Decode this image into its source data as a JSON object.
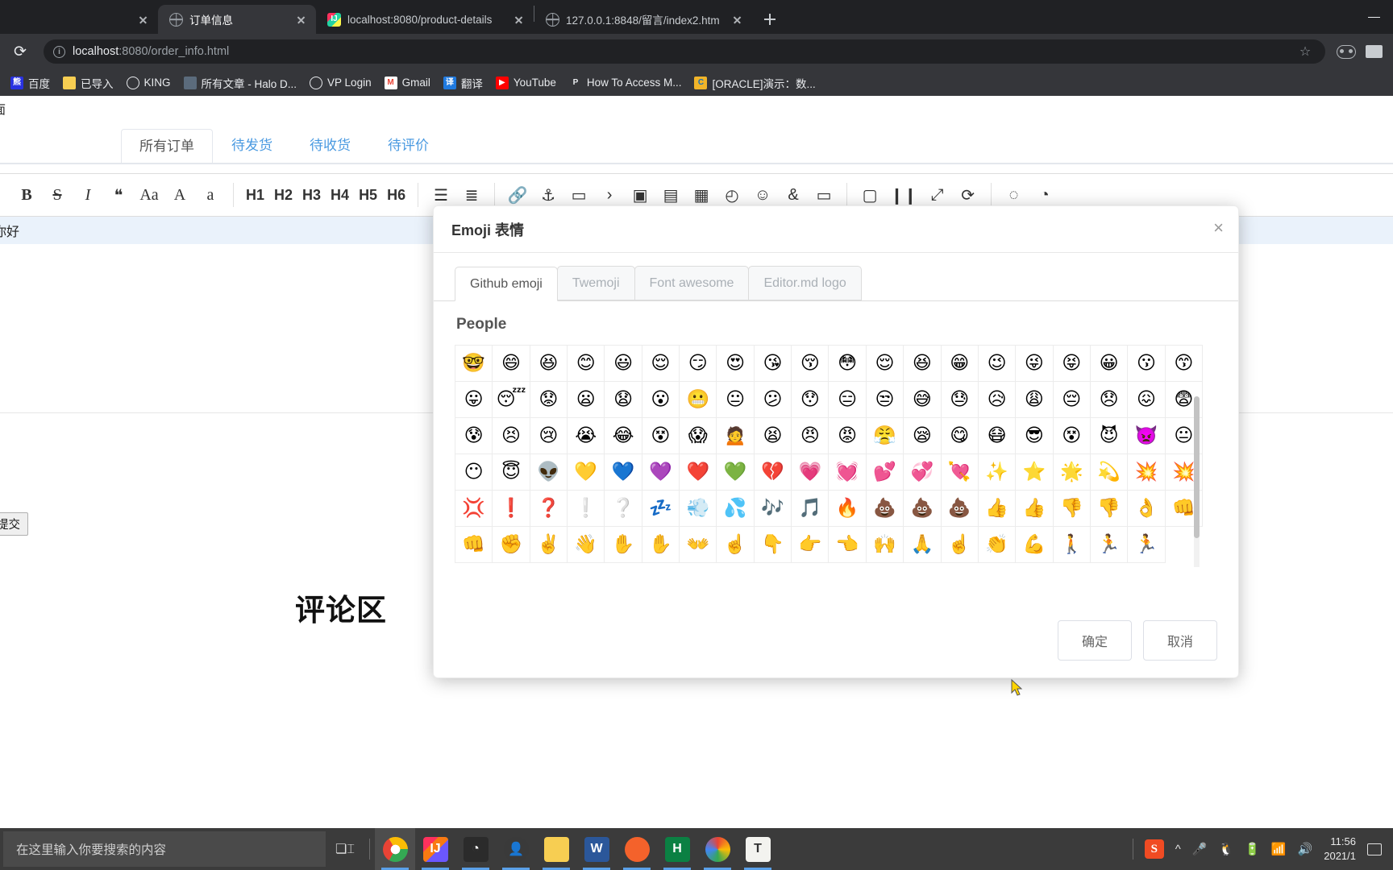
{
  "browser": {
    "tabs": [
      {
        "title": "",
        "favicon": "globe-icon",
        "active": false,
        "partial": true
      },
      {
        "title": "订单信息",
        "favicon": "globe-icon",
        "active": true,
        "partial": false
      },
      {
        "title": "localhost:8080/product-details",
        "favicon": "intellij-idea-icon",
        "active": false,
        "partial": false
      },
      {
        "title": "127.0.0.1:8848/留言/index2.htm",
        "favicon": "globe-icon",
        "active": false,
        "partial": false
      }
    ],
    "new_tab_label": "+",
    "minimize_label": "—",
    "omnibox": {
      "host": "localhost",
      "path": ":8080/order_info.html",
      "site_info_icon": "info-circle-icon",
      "star_icon": "☆"
    },
    "bookmarks": [
      {
        "label": "百度",
        "icon": "baidu-icon"
      },
      {
        "label": "已导入",
        "icon": "folder-icon"
      },
      {
        "label": "KING",
        "icon": "king-icon"
      },
      {
        "label": "所有文章 - Halo D...",
        "icon": "halo-icon"
      },
      {
        "label": "VP Login",
        "icon": "vp-icon"
      },
      {
        "label": "Gmail",
        "icon": "gmail-icon"
      },
      {
        "label": "翻译",
        "icon": "translate-icon"
      },
      {
        "label": "YouTube",
        "icon": "youtube-icon"
      },
      {
        "label": "How To Access M...",
        "icon": "pocket-icon"
      },
      {
        "label": "[ORACLE]演示：数...",
        "icon": "oracle-icon"
      }
    ]
  },
  "page": {
    "top_fragment_text": "面",
    "order_tabs": [
      {
        "label": "所有订单",
        "active": true
      },
      {
        "label": "待发货",
        "active": false
      },
      {
        "label": "待收货",
        "active": false
      },
      {
        "label": "待评价",
        "active": false
      }
    ],
    "editor_toolbar": [
      {
        "icon": "bold-icon",
        "glyph": "B"
      },
      {
        "icon": "strikethrough-icon",
        "glyph": "S"
      },
      {
        "icon": "italic-icon",
        "glyph": "I"
      },
      {
        "icon": "quote-icon",
        "glyph": "❝"
      },
      {
        "icon": "font-size-icon",
        "glyph": "Aa"
      },
      {
        "icon": "uppercase-icon",
        "glyph": "A"
      },
      {
        "icon": "lowercase-icon",
        "glyph": "a"
      },
      {
        "icon": "heading-1-icon",
        "glyph": "H1"
      },
      {
        "icon": "heading-2-icon",
        "glyph": "H2"
      },
      {
        "icon": "heading-3-icon",
        "glyph": "H3"
      },
      {
        "icon": "heading-4-icon",
        "glyph": "H4"
      },
      {
        "icon": "heading-5-icon",
        "glyph": "H5"
      },
      {
        "icon": "heading-6-icon",
        "glyph": "H6"
      },
      {
        "icon": "unordered-list-icon",
        "glyph": "☰"
      },
      {
        "icon": "ordered-list-icon",
        "glyph": "≣"
      },
      {
        "icon": "link-icon",
        "glyph": "🔗"
      },
      {
        "icon": "reference-link-icon",
        "glyph": "⚓"
      },
      {
        "icon": "image-icon",
        "glyph": "▭"
      },
      {
        "icon": "code-icon",
        "glyph": "›"
      },
      {
        "icon": "code-block-icon",
        "glyph": "▣"
      },
      {
        "icon": "preformatted-icon",
        "glyph": "▤"
      },
      {
        "icon": "table-icon",
        "glyph": "▦"
      },
      {
        "icon": "datetime-icon",
        "glyph": "◴"
      },
      {
        "icon": "emoji-icon",
        "glyph": "☺"
      },
      {
        "icon": "html-entity-icon",
        "glyph": "&"
      },
      {
        "icon": "page-break-icon",
        "glyph": "▭"
      },
      {
        "icon": "preview-icon",
        "glyph": "▢"
      },
      {
        "icon": "watch-icon",
        "glyph": "❙❙"
      },
      {
        "icon": "fullscreen-icon",
        "glyph": "⤢"
      },
      {
        "icon": "clear-icon",
        "glyph": "⟳"
      },
      {
        "icon": "search-icon",
        "glyph": "◌"
      },
      {
        "icon": "help-icon",
        "glyph": "◔"
      }
    ],
    "editor_line_text": "你好",
    "submit_button": "提交",
    "comment_heading": "评论区"
  },
  "emoji_modal": {
    "title": "Emoji 表情",
    "close_icon": "×",
    "tabs": [
      {
        "label": "Github emoji",
        "active": true
      },
      {
        "label": "Twemoji",
        "active": false
      },
      {
        "label": "Font awesome",
        "active": false
      },
      {
        "label": "Editor.md logo",
        "active": false
      }
    ],
    "section_title": "People",
    "emojis": [
      "🤓",
      "😄",
      "😆",
      "😊",
      "😃",
      "😌",
      "😏",
      "😍",
      "😘",
      "😚",
      "😳",
      "😌",
      "😆",
      "😁",
      "😉",
      "😜",
      "😝",
      "😀",
      "😗",
      "😙",
      "😛",
      "😴",
      "😟",
      "😦",
      "😧",
      "😮",
      "😬",
      "😐",
      "😕",
      "😯",
      "😑",
      "😒",
      "😅",
      "😓",
      "😥",
      "😩",
      "😔",
      "😞",
      "😖",
      "😨",
      "😰",
      "😣",
      "😢",
      "😭",
      "😂",
      "😵",
      "😱",
      "🙍",
      "😫",
      "😠",
      "😡",
      "😤",
      "😪",
      "😋",
      "😷",
      "😎",
      "😵",
      "😈",
      "👿",
      "😐",
      "😶",
      "😇",
      "👽",
      "💛",
      "💙",
      "💜",
      "❤️",
      "💚",
      "💔",
      "💗",
      "💓",
      "💕",
      "💞",
      "💘",
      "✨",
      "⭐",
      "🌟",
      "💫",
      "💥",
      "💥",
      "💢",
      "❗",
      "❓",
      "❕",
      "❔",
      "💤",
      "💨",
      "💦",
      "🎶",
      "🎵",
      "🔥",
      "💩",
      "💩",
      "💩",
      "👍",
      "👍",
      "👎",
      "👎",
      "👌",
      "👊",
      "👊",
      "✊",
      "✌️",
      "👋",
      "✋",
      "✋",
      "👐",
      "☝️",
      "👇",
      "👉",
      "👈",
      "🙌",
      "🙏",
      "☝️",
      "👏",
      "💪",
      "🚶",
      "🏃",
      "🏃"
    ],
    "confirm_button": "确定",
    "cancel_button": "取消"
  },
  "taskbar": {
    "search_placeholder": "在这里输入你要搜索的内容",
    "task_view_icon": "task-view-icon",
    "apps": [
      {
        "name": "chrome",
        "label": "",
        "running": true
      },
      {
        "name": "intellij-idea",
        "label": "",
        "running": true
      },
      {
        "name": "navicat",
        "label": "",
        "running": true
      },
      {
        "name": "qq-person",
        "label": "",
        "running": true
      },
      {
        "name": "file-explorer",
        "label": "",
        "running": true
      },
      {
        "name": "word",
        "label": "W",
        "running": true
      },
      {
        "name": "postman",
        "label": "",
        "running": true
      },
      {
        "name": "halo",
        "label": "H",
        "running": true
      },
      {
        "name": "google-photos",
        "label": "",
        "running": true
      },
      {
        "name": "typora",
        "label": "T",
        "running": true
      }
    ],
    "tray": {
      "snipaste_label": "S",
      "chevron_icon": "^",
      "mic_icon": "mic-icon",
      "qq_icon": "qq-penguin-icon",
      "battery_icon": "battery-icon",
      "wifi_icon": "wifi-icon",
      "volume_icon": "volume-icon",
      "time": "11:56",
      "date": "2021/1"
    }
  }
}
